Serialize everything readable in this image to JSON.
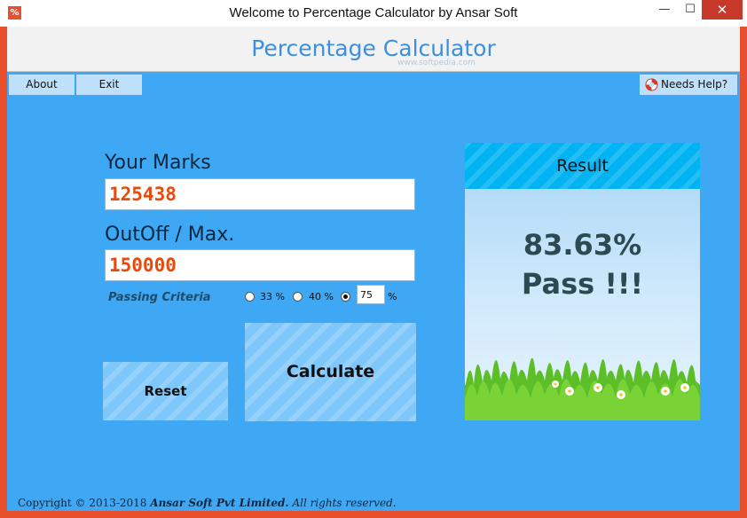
{
  "window": {
    "title": "Welcome to Percentage Calculator by Ansar Soft",
    "icon_text": "%",
    "minimize": "—",
    "maximize": "☐",
    "close": "✕"
  },
  "header": {
    "title": "Percentage Calculator",
    "watermark": "www.softpedia.com"
  },
  "menu": {
    "about": "About",
    "exit": "Exit",
    "help": "Needs Help?"
  },
  "form": {
    "marks_label": "Your Marks",
    "marks_value": "125438",
    "max_label": "OutOff / Max.",
    "max_value": "150000",
    "criteria_label": "Passing Criteria",
    "option_33": "33 %",
    "option_40": "40 %",
    "custom_value": "75",
    "percent_sign": "%",
    "selected_option": "custom"
  },
  "buttons": {
    "reset": "Reset",
    "calculate": "Calculate"
  },
  "result": {
    "header": "Result",
    "percentage": "83.63%",
    "status": "Pass !!!"
  },
  "footer": {
    "copyright": "Copyright © 2013-2018",
    "company": "Ansar Soft Pvt Limited.",
    "rights": "All rights reserved."
  },
  "colors": {
    "window_border": "#e8502d",
    "client_bg": "#3fa8f4",
    "input_text": "#e84a0c",
    "header_title": "#3b8fe0",
    "result_text": "#2b4a52"
  },
  "icons": {
    "help": "lifebuoy-icon",
    "app": "percent-icon"
  }
}
